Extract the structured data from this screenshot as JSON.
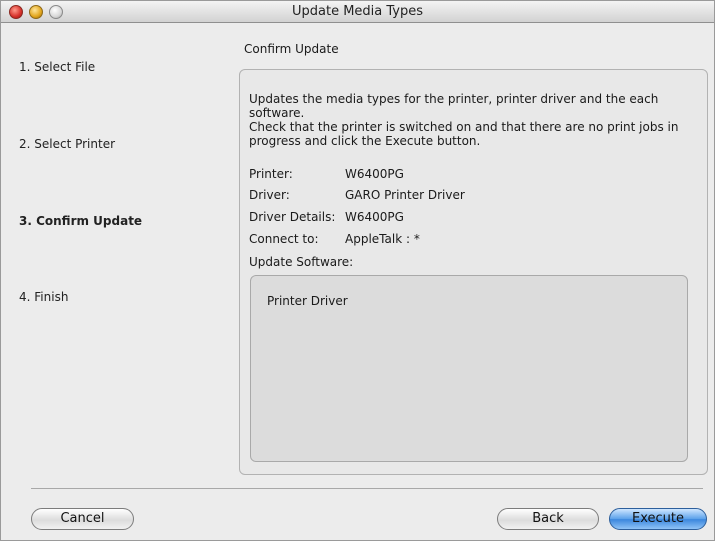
{
  "window": {
    "title": "Update Media Types"
  },
  "steps": [
    {
      "label": "1. Select File",
      "active": false
    },
    {
      "label": "2. Select Printer",
      "active": false
    },
    {
      "label": "3. Confirm Update",
      "active": true
    },
    {
      "label": "4. Finish",
      "active": false
    }
  ],
  "main": {
    "section_title": "Confirm Update",
    "description_line1": "Updates the media types for the printer, printer driver and the each software.",
    "description_line2": "Check that the printer is switched on and that there are no print jobs in progress and click the Execute button.",
    "info": [
      {
        "label": "Printer:",
        "value": "W6400PG"
      },
      {
        "label": "Driver:",
        "value": "GARO Printer Driver"
      },
      {
        "label": "Driver Details:",
        "value": "W6400PG"
      },
      {
        "label": "Connect to:",
        "value": "AppleTalk : *"
      }
    ],
    "update_software_label": "Update Software:",
    "software_items": [
      "Printer Driver"
    ]
  },
  "buttons": {
    "cancel": "Cancel",
    "back": "Back",
    "execute": "Execute"
  }
}
